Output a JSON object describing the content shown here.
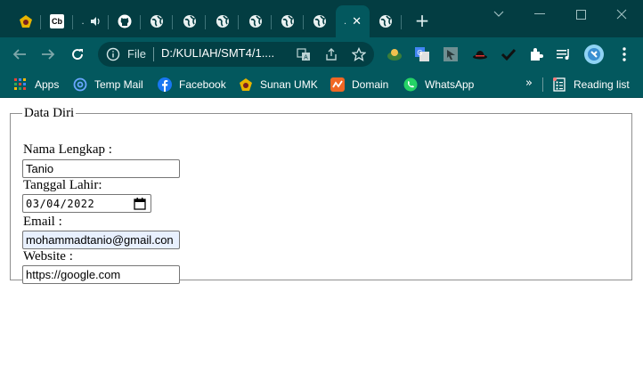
{
  "browser": {
    "active_tab_title": ".",
    "tab_titles": [
      ".",
      "."
    ],
    "close_glyph": "✕",
    "new_tab_glyph": "+",
    "favicon_cb_text": "Cb"
  },
  "toolbar": {
    "file_label": "File",
    "url": "D:/KULIAH/SMT4/1...."
  },
  "bookmarks": {
    "items": [
      {
        "label": "Apps",
        "icon": "apps-grid-icon"
      },
      {
        "label": "Temp Mail",
        "icon": "at-sign-icon"
      },
      {
        "label": "Facebook",
        "icon": "facebook-icon"
      },
      {
        "label": "Sunan UMK",
        "icon": "umk-logo-icon"
      },
      {
        "label": "Domain",
        "icon": "domain-icon"
      },
      {
        "label": "WhatsApp",
        "icon": "whatsapp-icon"
      }
    ],
    "overflow_glyph": "»",
    "reading_list_label": "Reading list"
  },
  "form": {
    "legend": "Data Diri",
    "nama_label": "Nama Lengkap :",
    "nama_value": "Tanio",
    "tanggal_label": "Tanggal Lahir:",
    "tanggal_value": "03/04/2022",
    "email_label": "Email :",
    "email_value": "mohammadtanio@gmail.con",
    "website_label": "Website :",
    "website_value": "https://google.com"
  },
  "colors": {
    "tabstrip": "#033d42",
    "toolbar": "#03585e",
    "autofill": "#e8f0fe"
  }
}
